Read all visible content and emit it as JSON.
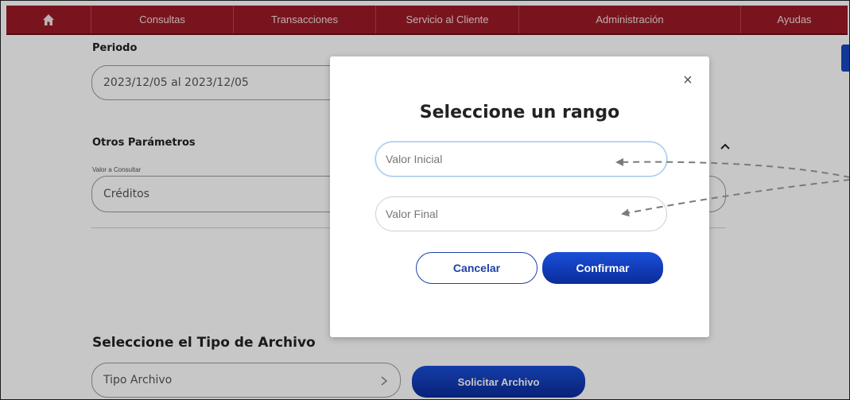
{
  "nav": {
    "items": [
      {
        "label": "Consultas"
      },
      {
        "label": "Transacciones"
      },
      {
        "label": "Servicio al Cliente"
      },
      {
        "label": "Administración"
      },
      {
        "label": "Ayudas"
      }
    ],
    "home_icon": "home-icon"
  },
  "form": {
    "periodo_label": "Periodo",
    "periodo_value": "2023/12/05 al 2023/12/05",
    "otros_label": "Otros Parámetros",
    "valor_consultar_label": "Valor a Consultar",
    "valor_consultar_value": "Créditos",
    "tipo_archivo_heading": "Seleccione el Tipo de Archivo",
    "tipo_archivo_value": "Tipo Archivo",
    "solicitar_label": "Solicitar Archivo"
  },
  "modal": {
    "title": "Seleccione un rango",
    "close_icon": "close-icon",
    "valor_inicial_placeholder": "Valor Inicial",
    "valor_final_placeholder": "Valor Final",
    "cancel_label": "Cancelar",
    "confirm_label": "Confirmar"
  },
  "colors": {
    "nav_bg": "#9b1a28",
    "primary_blue": "#0b2c9a",
    "accent_blue": "#1a4fd8"
  }
}
